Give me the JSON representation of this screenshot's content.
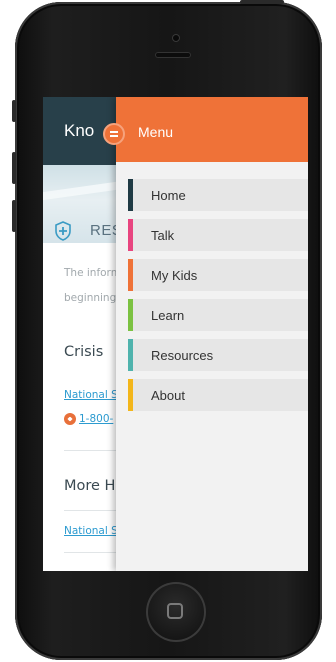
{
  "app": {
    "logo_text": "Kno",
    "section_title": "RES",
    "intro_line_1": "The inform",
    "intro_line_2": "beginning",
    "heading_crisis": "Crisis",
    "link_1": "National S",
    "phone_link": "1-800-",
    "heading_more": "More He",
    "link_2": "National S"
  },
  "menu": {
    "title": "Menu",
    "items": [
      {
        "label": "Home",
        "color": "#1f3a44"
      },
      {
        "label": "Talk",
        "color": "#e8457f"
      },
      {
        "label": "My Kids",
        "color": "#ef7238"
      },
      {
        "label": "Learn",
        "color": "#7cc242"
      },
      {
        "label": "Resources",
        "color": "#4fb3ad"
      },
      {
        "label": "About",
        "color": "#f3b61b"
      }
    ]
  },
  "colors": {
    "header_bg": "#28404a",
    "menu_header": "#ef7238",
    "link": "#2d9bd0"
  }
}
